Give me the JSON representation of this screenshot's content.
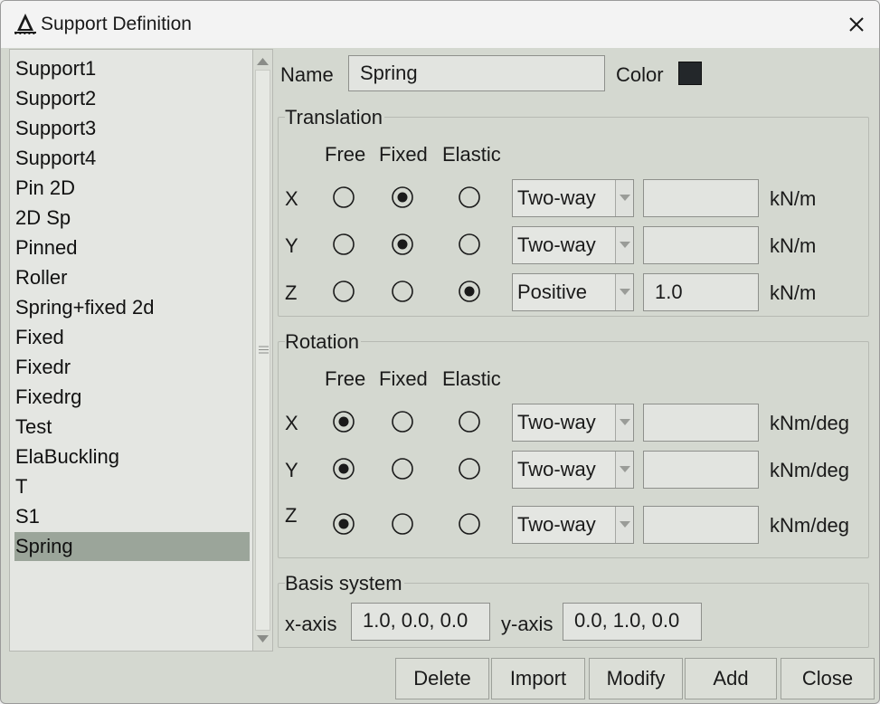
{
  "window": {
    "title": "Support Definition"
  },
  "list": {
    "items": [
      "Support1",
      "Support2",
      "Support3",
      "Support4",
      "Pin 2D",
      "2D Sp",
      "Pinned",
      "Roller",
      "Spring+fixed 2d",
      "Fixed",
      "Fixedr",
      "Fixedrg",
      "Test",
      "ElaBuckling",
      "T",
      "S1",
      "Spring"
    ],
    "selected": "Spring"
  },
  "form": {
    "name_label": "Name",
    "name_value": "Spring",
    "color_label": "Color",
    "color_value": "#23272a"
  },
  "translation": {
    "title": "Translation",
    "headers": [
      "Free",
      "Fixed",
      "Elastic"
    ],
    "rows": [
      {
        "axis": "X",
        "selected": "Fixed",
        "type": "Two-way",
        "value": "",
        "unit": "kN/m"
      },
      {
        "axis": "Y",
        "selected": "Fixed",
        "type": "Two-way",
        "value": "",
        "unit": "kN/m"
      },
      {
        "axis": "Z",
        "selected": "Elastic",
        "type": "Positive",
        "value": "1.0",
        "unit": "kN/m"
      }
    ]
  },
  "rotation": {
    "title": "Rotation",
    "headers": [
      "Free",
      "Fixed",
      "Elastic"
    ],
    "rows": [
      {
        "axis": "X",
        "selected": "Free",
        "type": "Two-way",
        "value": "",
        "unit": "kNm/deg"
      },
      {
        "axis": "Y",
        "selected": "Free",
        "type": "Two-way",
        "value": "",
        "unit": "kNm/deg"
      },
      {
        "axis": "Z",
        "selected": "Free",
        "type": "Two-way",
        "value": "",
        "unit": "kNm/deg"
      }
    ]
  },
  "basis": {
    "title": "Basis system",
    "x_label": "x-axis",
    "x_value": "1.0, 0.0, 0.0",
    "y_label": "y-axis",
    "y_value": "0.0, 1.0, 0.0"
  },
  "buttons": {
    "delete": "Delete",
    "import": "Import",
    "modify": "Modify",
    "add": "Add",
    "close": "Close"
  },
  "icons": {
    "app": "structure-logo-icon",
    "close": "close-icon",
    "scroll_up": "chevron-up-icon",
    "scroll_down": "chevron-down-icon",
    "dropdown": "dropdown-arrow-icon"
  }
}
